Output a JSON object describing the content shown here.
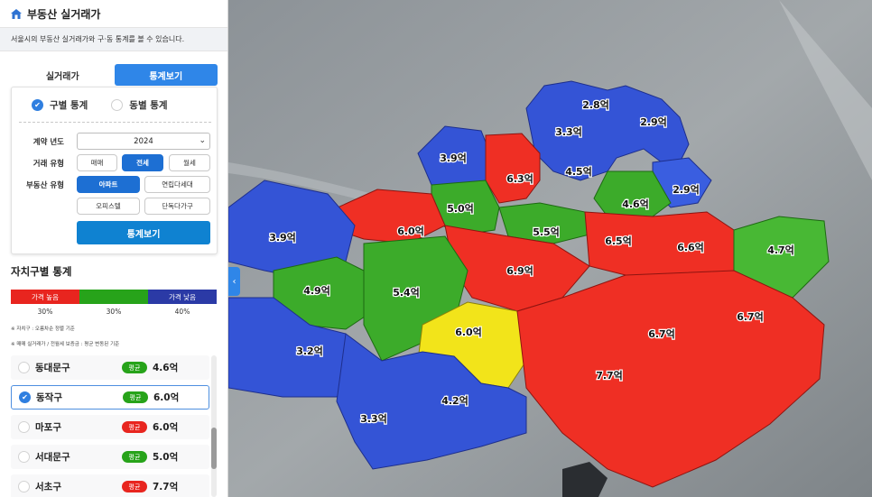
{
  "app": {
    "title": "부동산 실거래가",
    "description": "서울시의 부동산 실거래가와 구·동 통계를 볼 수 있습니다."
  },
  "tabs": [
    {
      "label": "실거래가",
      "active": false
    },
    {
      "label": "통계보기",
      "active": true
    }
  ],
  "filter": {
    "scope": [
      {
        "label": "구별 통계",
        "checked": true
      },
      {
        "label": "동별 통계",
        "checked": false
      }
    ],
    "year_label": "계약 년도",
    "year_value": "2024",
    "deal_type_label": "거래 유형",
    "deal_types": [
      {
        "label": "매매",
        "active": false
      },
      {
        "label": "전세",
        "active": true
      },
      {
        "label": "월세",
        "active": false
      }
    ],
    "property_type_label": "부동산 유형",
    "property_types": [
      {
        "label": "아파트",
        "active": true
      },
      {
        "label": "연립다세대",
        "active": false
      },
      {
        "label": "오피스텔",
        "active": false
      },
      {
        "label": "단독다가구",
        "active": false
      }
    ],
    "submit_label": "통계보기"
  },
  "stats": {
    "title": "자치구별 통계",
    "legend": [
      {
        "label": "가격 높음",
        "color": "#e8251f",
        "pct": "30%"
      },
      {
        "label": "",
        "color": "#27a31a",
        "pct": "30%"
      },
      {
        "label": "가격 낮음",
        "color": "#2b3aa6",
        "pct": "40%"
      }
    ],
    "notes": [
      "※ 자치구 : 오름차순 정렬 기준",
      "※ 매매 실거래가 / 전월세 보증금 : 평균 변동된 기준"
    ]
  },
  "districts": [
    {
      "name": "동대문구",
      "badge": "평균",
      "badge_color": "#27a31a",
      "value": "4.6억",
      "selected": false
    },
    {
      "name": "동작구",
      "badge": "평균",
      "badge_color": "#27a31a",
      "value": "6.0억",
      "selected": true
    },
    {
      "name": "마포구",
      "badge": "평균",
      "badge_color": "#e8251f",
      "value": "6.0억",
      "selected": false
    },
    {
      "name": "서대문구",
      "badge": "평균",
      "badge_color": "#27a31a",
      "value": "5.0억",
      "selected": false
    },
    {
      "name": "서초구",
      "badge": "평균",
      "badge_color": "#e8251f",
      "value": "7.7억",
      "selected": false
    }
  ],
  "map": {
    "labels": [
      {
        "text": "2.8억"
      },
      {
        "text": "2.9억"
      },
      {
        "text": "3.3억"
      },
      {
        "text": "3.9억"
      },
      {
        "text": "6.3억"
      },
      {
        "text": "4.5억"
      },
      {
        "text": "2.9억"
      },
      {
        "text": "4.6억"
      },
      {
        "text": "5.0억"
      },
      {
        "text": "6.0억"
      },
      {
        "text": "5.5억"
      },
      {
        "text": "3.9억"
      },
      {
        "text": "6.5억"
      },
      {
        "text": "6.6억"
      },
      {
        "text": "4.7억"
      },
      {
        "text": "6.9억"
      },
      {
        "text": "4.9억"
      },
      {
        "text": "5.4억"
      },
      {
        "text": "6.7억"
      },
      {
        "text": "6.0억"
      },
      {
        "text": "6.7억"
      },
      {
        "text": "3.2억"
      },
      {
        "text": "7.7억"
      },
      {
        "text": "4.2억"
      },
      {
        "text": "3.3억"
      }
    ]
  }
}
